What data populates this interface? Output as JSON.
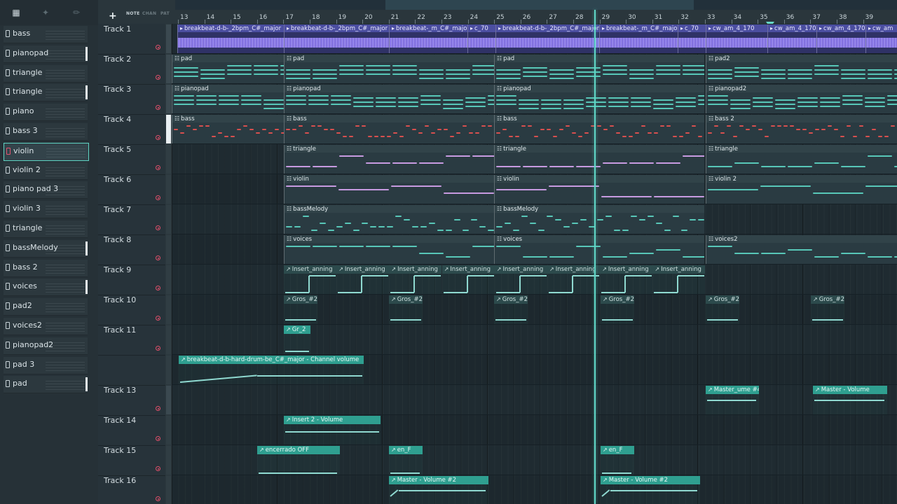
{
  "picker": {
    "toolbar": {
      "icon_a": "playlist-icon",
      "icon_b": "audio-icon",
      "icon_c": "brush-icon"
    },
    "items": [
      "bass",
      "pianopad",
      "triangle",
      "triangle",
      "piano",
      "bass 3",
      "violin",
      "violin 2",
      "piano pad 3",
      "violin 3",
      "triangle",
      "bassMelody",
      "bass 2",
      "voices",
      "pad2",
      "voices2",
      "pianopad2",
      "pad 3",
      "pad"
    ],
    "active_index": 6
  },
  "header": {
    "plus": "+",
    "tabs": [
      "NOTE",
      "CHAN",
      "PAT"
    ],
    "ruler": [
      "13",
      "14",
      "15",
      "16",
      "17",
      "18",
      "19",
      "20",
      "21",
      "22",
      "23",
      "24",
      "25",
      "26",
      "27",
      "28",
      "29",
      "30",
      "31",
      "32",
      "33",
      "34",
      "35",
      "36",
      "37",
      "38",
      "39"
    ]
  },
  "tracks": [
    "Track 1",
    "Track 2",
    "Track 3",
    "Track 4",
    "Track 5",
    "Track 6",
    "Track 7",
    "Track 8",
    "Track 9",
    "Track 10",
    "Track 11",
    "",
    "Track 13",
    "Track 14",
    "Track 15",
    "Track 16"
  ],
  "clips": {
    "t1": [
      "breakbeat-d-b-_2bpm_C#_major",
      "breakbeat-d-b-_2bpm_C#_major",
      "breakbeat-_m_C#_majo",
      "c_70",
      "breakbeat-d-b-_2bpm_C#_major",
      "breakbeat-_m_C#_majo",
      "c_70",
      "cw_am_4_170",
      "cw_am_4_170",
      "cw_am_4_170",
      "cw_am"
    ],
    "t2": [
      "pad",
      "pad",
      "pad",
      "pad2"
    ],
    "t3": [
      "pianopad",
      "pianopad",
      "pianopad",
      "pianopad2"
    ],
    "t4": [
      "bass",
      "bass",
      "bass",
      "bass 2"
    ],
    "t5": [
      "triangle",
      "triangle",
      "triangle"
    ],
    "t6": [
      "violin",
      "violin",
      "violin 2"
    ],
    "t7": [
      "bassMelody",
      "bassMelody"
    ],
    "t8": [
      "voices",
      "voices",
      "voices2"
    ],
    "t9": [
      "Insert_anning",
      "Insert_anning",
      "Insert_anning",
      "Insert_anning",
      "Insert_anning",
      "Insert_anning",
      "Insert_anning",
      "Insert_anning"
    ],
    "t10": [
      "Gros_#2",
      "Gros_#2",
      "Gros_#2",
      "Gros_#2",
      "Gros_#2",
      "Gros_#2"
    ],
    "t11": [
      "Gr_2"
    ],
    "t12": [
      "breakbeat-d-b-hard-drum-be_C#_major - Channel volume"
    ],
    "t13": [
      "Master_ume #4",
      "Master - Volume"
    ],
    "t14": [
      "Insert 2 - Volume"
    ],
    "t15": [
      "encerrado OFF",
      "en_F",
      "en_F"
    ],
    "t16": [
      "Master - Volume #2",
      "Master - Volume #2"
    ]
  },
  "colors": {
    "playhead": "#5fd6c6",
    "audio": "#4b4ea0",
    "automation": "#2f9f90",
    "note_teal": "#58c7b8",
    "note_lilac": "#c79ae0",
    "note_red": "#d8504f"
  }
}
